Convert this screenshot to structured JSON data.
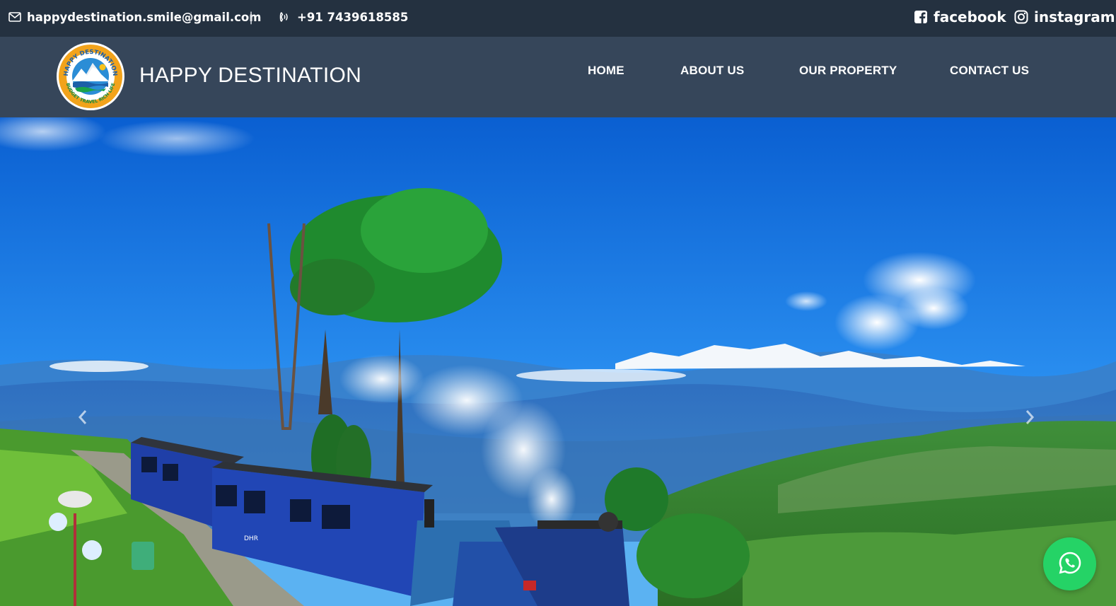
{
  "topbar": {
    "email": "happydestination.smile@gmail.com",
    "separator": "|",
    "phone": "+91 7439618585",
    "facebook_label": "facebook",
    "instagram_label": "instagram",
    "icons": {
      "email": "envelope-icon",
      "phone": "phone-volume-icon",
      "facebook": "facebook-square-icon",
      "instagram": "instagram-icon"
    }
  },
  "navbar": {
    "brand": "HAPPY DESTINATION",
    "logo": {
      "top_text": "HAPPY DESTINATION",
      "bottom_text": "BUDGET TRAVEL RICH LIFE"
    },
    "links": [
      {
        "label": "HOME"
      },
      {
        "label": "ABOUT US"
      },
      {
        "label": "OUR PROPERTY"
      },
      {
        "label": "CONTACT US"
      }
    ]
  },
  "hero": {
    "image": "darjeeling-toy-train-photo",
    "prev_icon": "chevron-left-icon",
    "next_icon": "chevron-right-icon",
    "train_marking": "DHR"
  },
  "floating": {
    "whatsapp_icon": "whatsapp-icon"
  },
  "colors": {
    "topbar_bg": "#243140",
    "navbar_bg": "#36465a",
    "whatsapp": "#25d366",
    "sky": "#1e7fe0"
  }
}
